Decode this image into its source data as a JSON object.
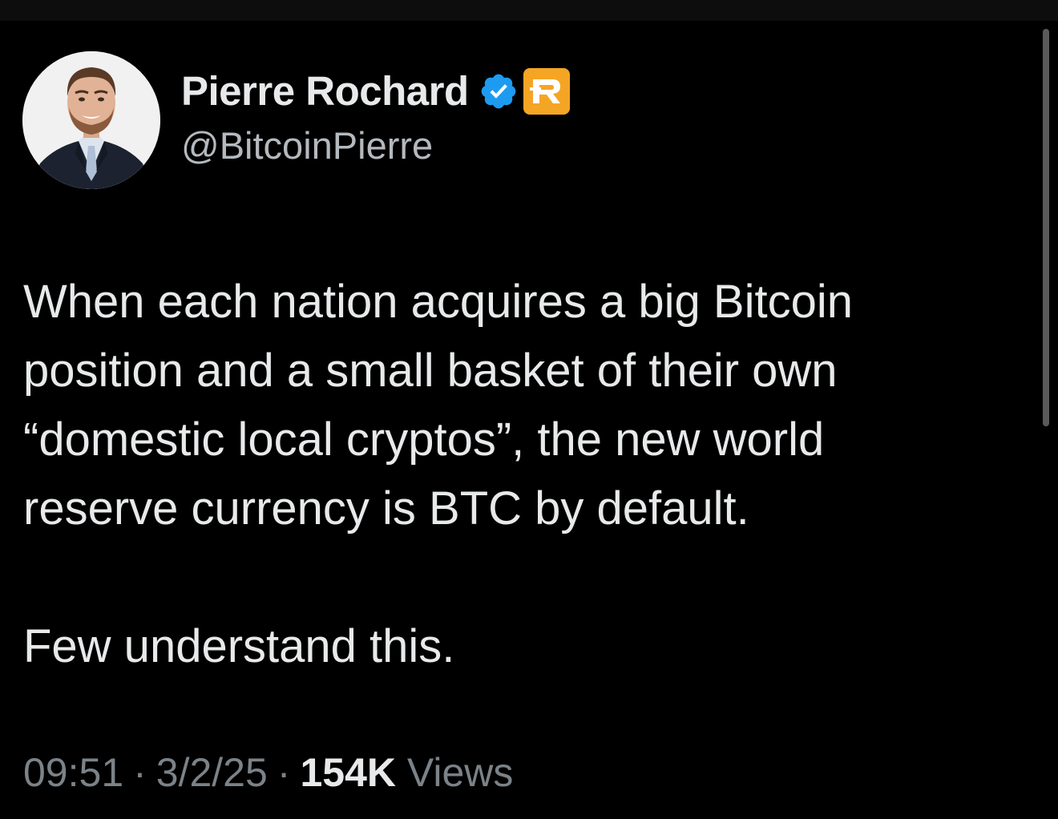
{
  "author": {
    "display_name": "Pierre Rochard",
    "handle": "@BitcoinPierre",
    "verified_icon": "verified-badge-icon",
    "affiliate_icon": "affiliate-logo-icon",
    "avatar": "profile-photo"
  },
  "tweet": {
    "paragraph_1": "When each nation acquires a big Bitcoin\nposition and a small basket of their own\n“domestic local cryptos”, the new world\nreserve currency is BTC by default.",
    "paragraph_2": "Few understand this."
  },
  "meta": {
    "time": "09:51",
    "separator": "·",
    "date": "3/2/25",
    "views_count": "154K",
    "views_label": "Views"
  },
  "colors": {
    "background": "#000000",
    "text": "#e7e9ea",
    "secondary_text": "#7b8288",
    "verified_blue": "#1d9bf0",
    "affiliate_orange": "#f5a524"
  }
}
